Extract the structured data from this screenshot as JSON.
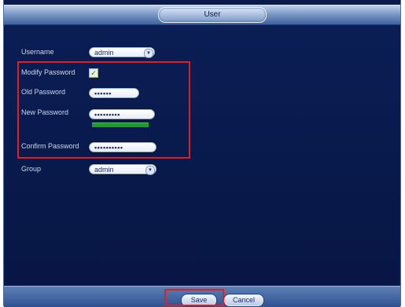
{
  "window": {
    "title": "User"
  },
  "form": {
    "username": {
      "label": "Username",
      "value": "admin"
    },
    "modify_password": {
      "label": "Modify Password",
      "checked": true
    },
    "old_password": {
      "label": "Old Password",
      "value": "••••••"
    },
    "new_password": {
      "label": "New Password",
      "value": "•••••••••"
    },
    "confirm_password": {
      "label": "Confirm Password",
      "value": "••••••••••"
    },
    "group": {
      "label": "Group",
      "value": "admin"
    }
  },
  "buttons": {
    "save": "Save",
    "cancel": "Cancel"
  },
  "colors": {
    "highlight": "#e21e24",
    "strength_bar": "#1f9a2e",
    "panel": "#0a1a4a"
  }
}
